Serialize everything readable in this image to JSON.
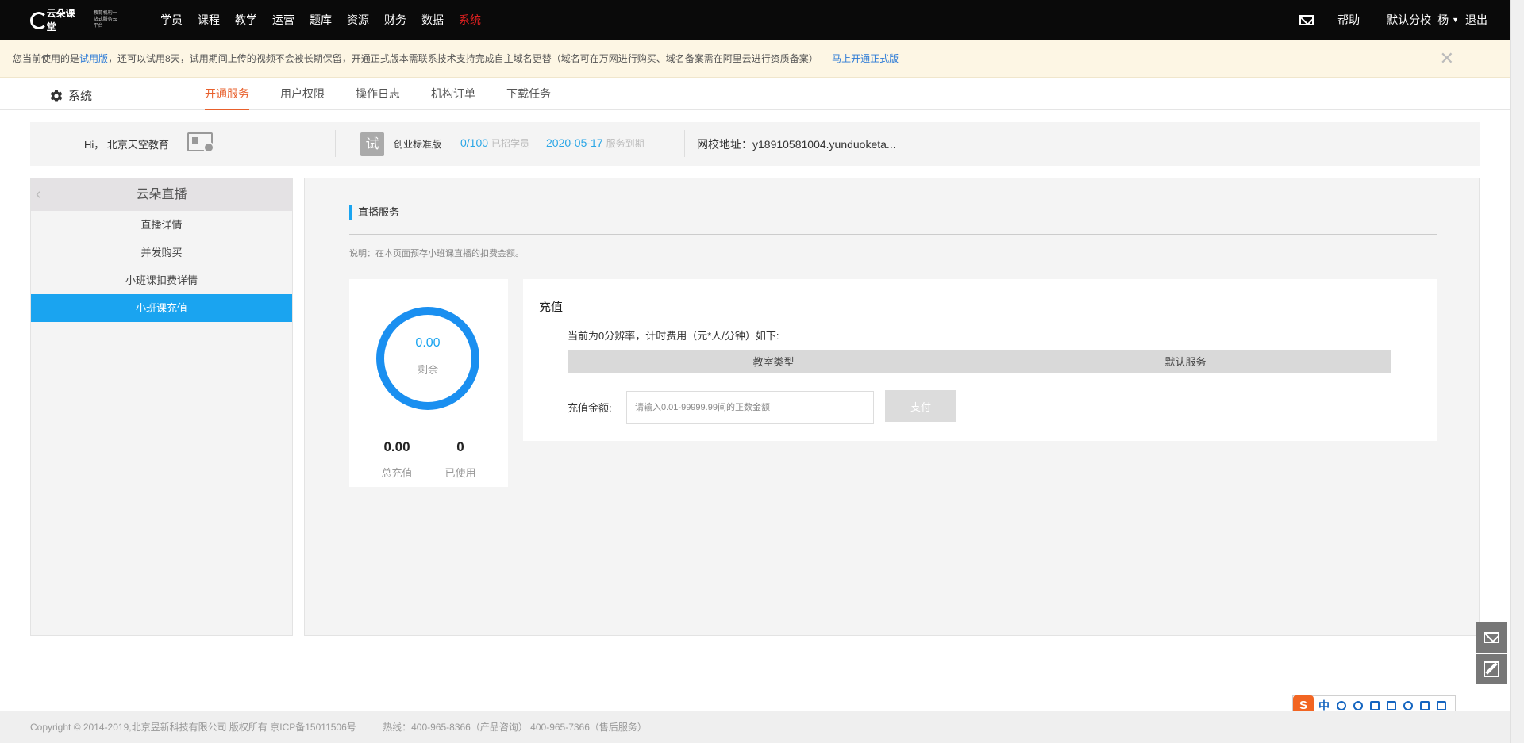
{
  "topnav": {
    "logo_text": "云朵课堂",
    "logo_sub": "教育机构一站式服务云平台",
    "items": [
      {
        "label": "学员"
      },
      {
        "label": "课程"
      },
      {
        "label": "教学"
      },
      {
        "label": "运营"
      },
      {
        "label": "题库"
      },
      {
        "label": "资源"
      },
      {
        "label": "财务"
      },
      {
        "label": "数据"
      },
      {
        "label": "系统",
        "active": true
      }
    ],
    "help": "帮助",
    "branch": "默认分校",
    "user": "杨",
    "logout": "退出"
  },
  "notice": {
    "prefix": "您当前使用的是",
    "version": "试用版",
    "text": "，还可以试用8天，试用期间上传的视频不会被长期保留，开通正式版本需联系技术支持完成自主域名更替（域名可在万网进行购买、域名备案需在阿里云进行资质备案）",
    "link": "马上开通正式版",
    "close": "✕"
  },
  "subnav": {
    "section": "系统",
    "tabs": [
      {
        "label": "开通服务",
        "active": true
      },
      {
        "label": "用户权限"
      },
      {
        "label": "操作日志"
      },
      {
        "label": "机构订单"
      },
      {
        "label": "下载任务"
      }
    ]
  },
  "infobar": {
    "greeting": "Hi，  北京天空教育",
    "badge": "试",
    "plan": "创业标准版",
    "students_value": "0/100",
    "students_label": "已招学员",
    "expire_value": "2020-05-17",
    "expire_label": "服务到期",
    "address": "网校地址：y18910581004.yunduoketa..."
  },
  "leftmenu": {
    "title": "云朵直播",
    "back": "‹",
    "items": [
      {
        "label": "直播详情"
      },
      {
        "label": "并发购买"
      },
      {
        "label": "小班课扣费详情"
      },
      {
        "label": "小班课充值",
        "active": true
      }
    ]
  },
  "main": {
    "section_title": "直播服务",
    "description": "说明：在本页面预存小班课直播的扣费金额。",
    "balance": {
      "remaining_value": "0.00",
      "remaining_label": "剩余",
      "total_value": "0.00",
      "total_label": "总充值",
      "used_value": "0",
      "used_label": "已使用"
    },
    "recharge": {
      "title": "充值",
      "rate_text": "当前为0分辨率，计时费用（元*人/分钟）如下:",
      "table_headers": [
        "教室类型",
        "默认服务"
      ],
      "amount_label": "充值金额:",
      "amount_value": "",
      "amount_placeholder": "请输入0.01-99999.99间的正数金额",
      "pay_button": "支付"
    }
  },
  "ime": {
    "logo": "S",
    "mode": "中"
  },
  "footer": {
    "copyright": "Copyright © 2014-2019,北京昱新科技有限公司 版权所有 京ICP备15011506号",
    "hotline": "热线：400-965-8366（产品咨询） 400-965-7366（售后服务）"
  },
  "colors": {
    "accent": "#1aa4f0",
    "active_tab": "#e8602c",
    "active_nav": "#e02020",
    "ring": "#1a8ff0",
    "notice_bg": "#fdf6e4"
  }
}
